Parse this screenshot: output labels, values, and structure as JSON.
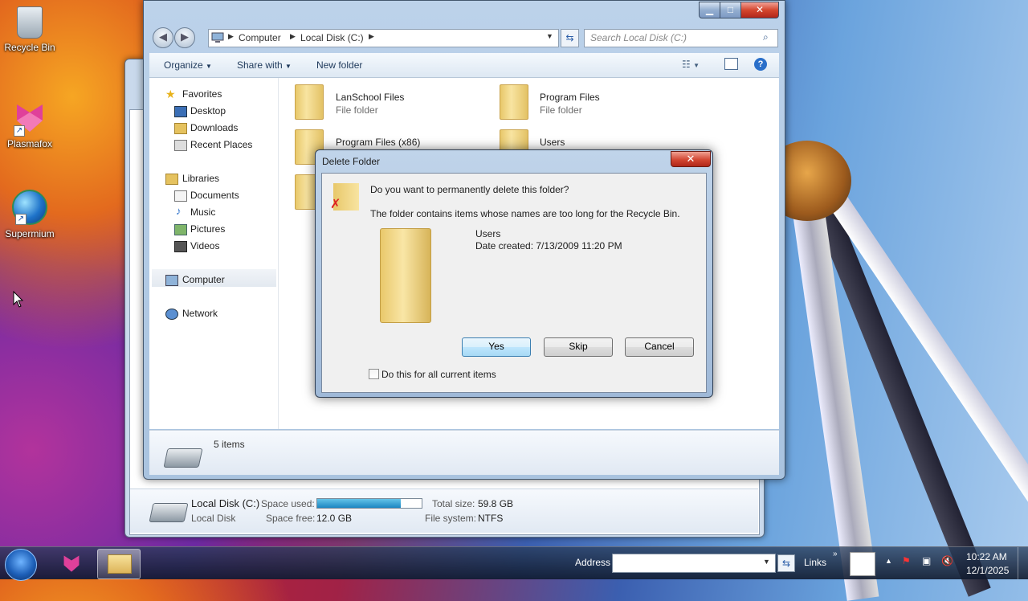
{
  "desktop": {
    "icons": [
      {
        "label": "Recycle Bin"
      },
      {
        "label": "Plasmafox"
      },
      {
        "label": "Supermium"
      }
    ]
  },
  "explorer": {
    "address": {
      "crumb_root": "Computer",
      "crumb_drive": "Local Disk (C:)"
    },
    "search_placeholder": "Search Local Disk (C:)",
    "toolbar": {
      "organize": "Organize",
      "share_with": "Share with",
      "new_folder": "New folder"
    },
    "nav": {
      "favorites": "Favorites",
      "desktop": "Desktop",
      "downloads": "Downloads",
      "recent_places": "Recent Places",
      "libraries": "Libraries",
      "documents": "Documents",
      "music": "Music",
      "pictures": "Pictures",
      "videos": "Videos",
      "computer": "Computer",
      "network": "Network"
    },
    "files": [
      {
        "name": "LanSchool Files",
        "type": "File folder"
      },
      {
        "name": "Program Files",
        "type": "File folder"
      },
      {
        "name": "Program Files (x86)",
        "type": ""
      },
      {
        "name": "Users",
        "type": ""
      }
    ],
    "status": {
      "items": "5 items"
    }
  },
  "back_window": {
    "drive_name": "Local Disk (C:)",
    "drive_type": "Local Disk",
    "space_used_label": "Space used:",
    "space_used_fraction": 0.8,
    "space_free_label": "Space free:",
    "space_free_value": "12.0 GB",
    "total_size_label": "Total size:",
    "total_size_value": "59.8 GB",
    "file_system_label": "File system:",
    "file_system_value": "NTFS"
  },
  "dialog": {
    "title": "Delete Folder",
    "question": "Do you want to permanently delete this folder?",
    "detail": "The folder contains items whose names are too long for the Recycle Bin.",
    "item_name": "Users",
    "item_date": "Date created: 7/13/2009 11:20 PM",
    "yes": "Yes",
    "skip": "Skip",
    "cancel": "Cancel",
    "checkbox": "Do this for all current items"
  },
  "taskbar": {
    "address_label": "Address",
    "links_label": "Links",
    "time": "10:22 AM",
    "date": "12/1/2025"
  }
}
